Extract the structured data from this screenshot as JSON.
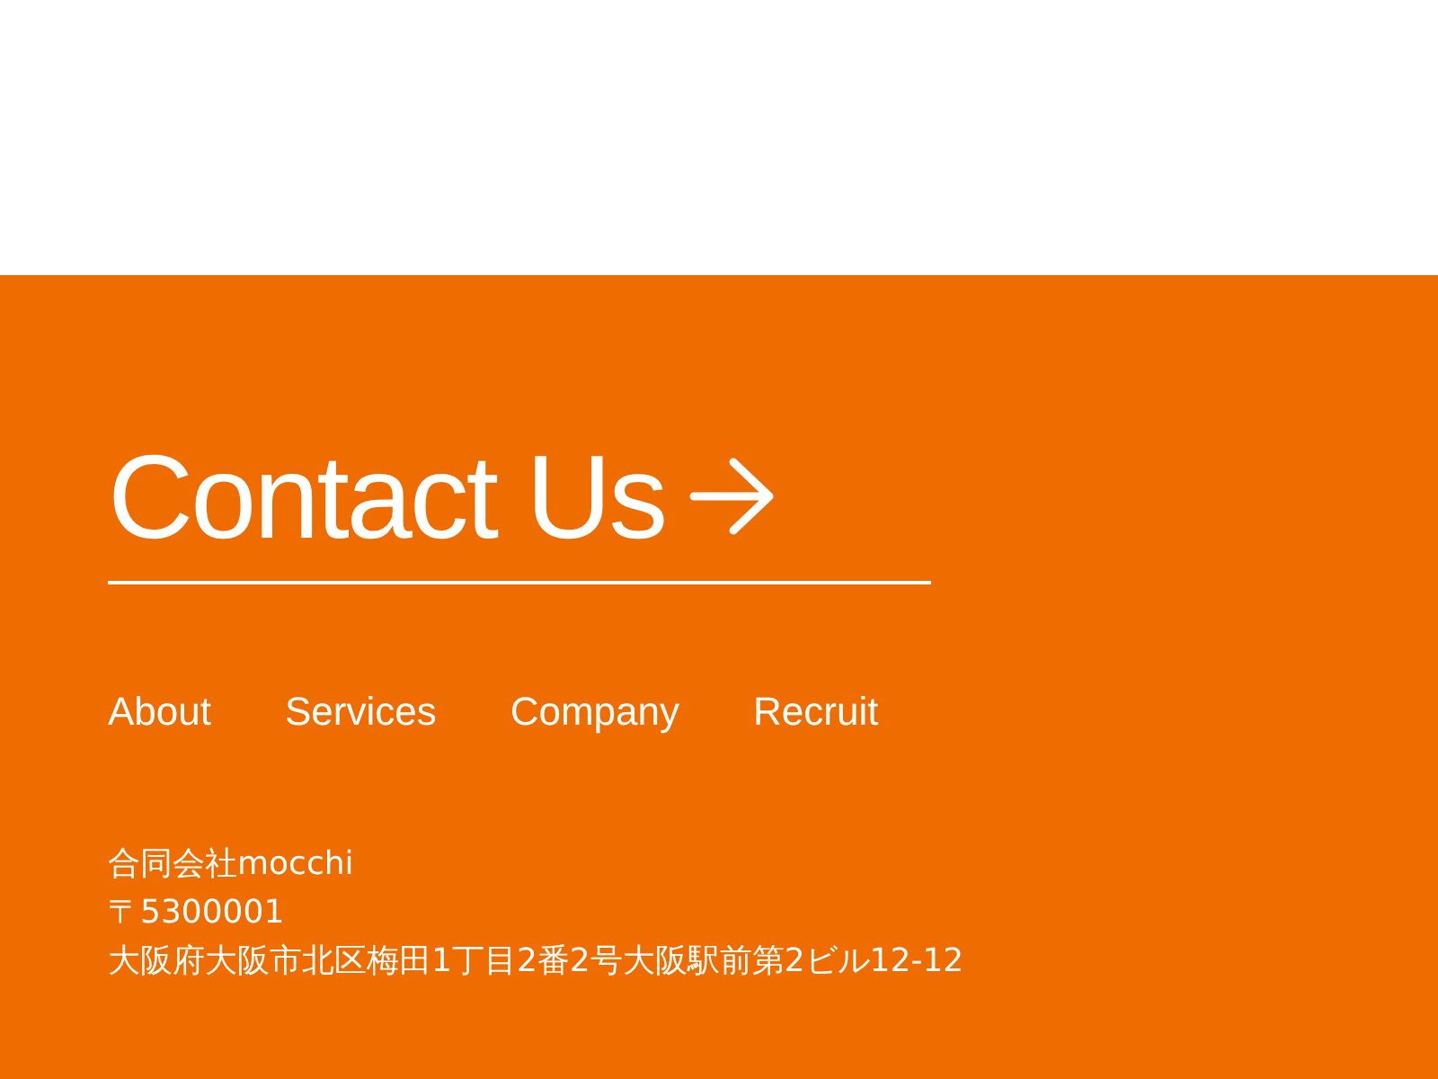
{
  "contact_link": {
    "label": "Contact Us"
  },
  "nav": [
    {
      "label": "About"
    },
    {
      "label": "Services"
    },
    {
      "label": "Company"
    },
    {
      "label": "Recruit"
    }
  ],
  "address": [
    "合同会社mocchi",
    "〒5300001",
    "大阪府大阪市北区梅田1丁目2番2号大阪駅前第2ビル12-12"
  ]
}
